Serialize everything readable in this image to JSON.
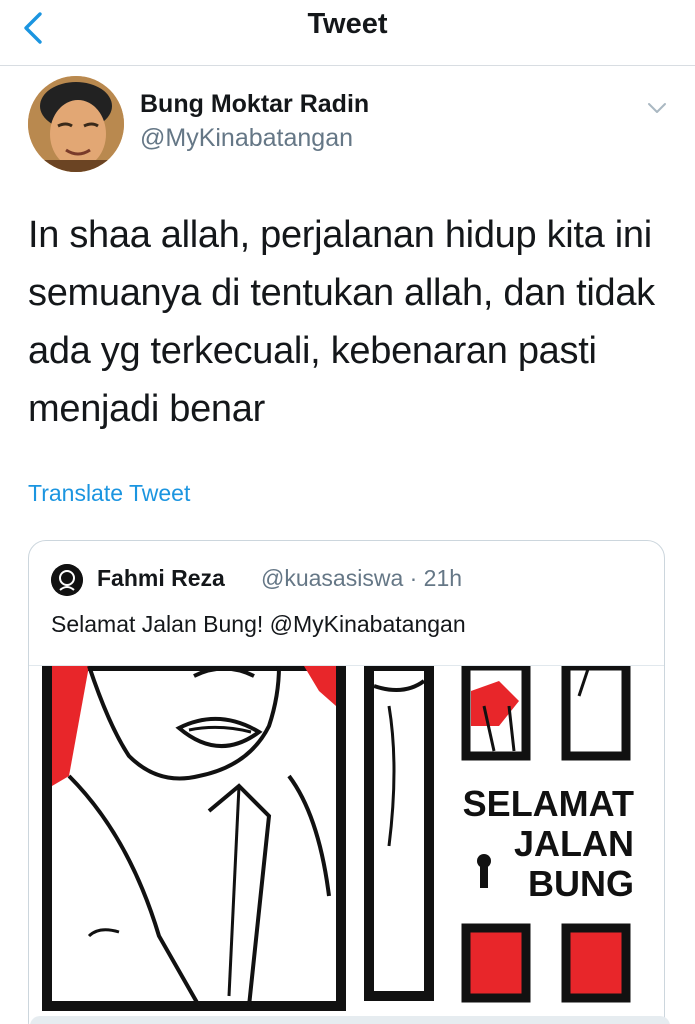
{
  "nav": {
    "title": "Tweet",
    "back_icon": "chevron-left-icon"
  },
  "author": {
    "display_name": "Bung Moktar Radin",
    "handle": "@MyKinabatangan",
    "menu_icon": "chevron-down-icon"
  },
  "tweet": {
    "lines": [
      "In shaa allah, perjalanan hidup kita ini",
      "semuanya di tentukan allah, dan tidak",
      "ada yg terkecuali, kebenaran pasti",
      "menjadi benar"
    ],
    "translate_label": "Translate Tweet"
  },
  "quoted": {
    "display_name": "Fahmi Reza",
    "handle_time": "@kuasasiswa · 21h",
    "text": "Selamat Jalan Bung! @MyKinabatangan",
    "poster_lines": [
      "SELAMAT",
      "JALAN",
      "BUNG"
    ]
  },
  "colors": {
    "accent": "#1b95e0",
    "poster_red": "#e8262a",
    "muted": "#657786"
  }
}
